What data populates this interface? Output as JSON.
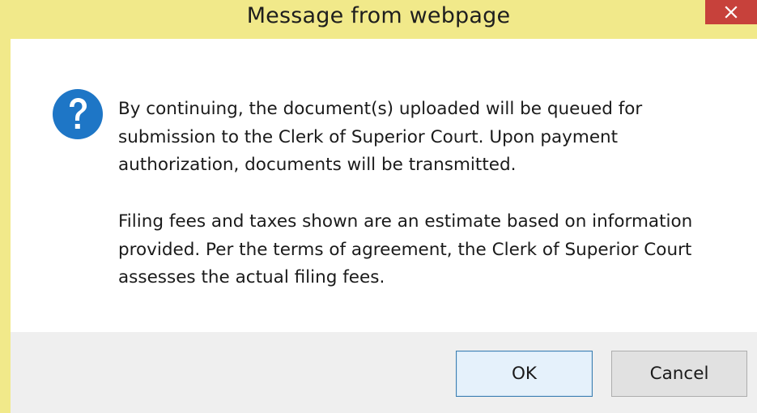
{
  "dialog": {
    "title": "Message from webpage",
    "close_icon": "close-icon",
    "icon": "question-icon",
    "message_paragraphs": [
      "By continuing, the document(s) uploaded will be queued for\nsubmission to the Clerk of Superior Court. Upon payment\nauthorization, documents will be transmitted.",
      "Filing fees and taxes shown are an estimate based on information\nprovided. Per the terms of agreement, the Clerk of Superior Court\nassesses the actual filing fees."
    ],
    "ok_label": "OK",
    "cancel_label": "Cancel"
  },
  "colors": {
    "titlebar": "#f1e98a",
    "close_button": "#c7413b",
    "question_icon": "#1e76c6",
    "footer": "#efefef"
  }
}
